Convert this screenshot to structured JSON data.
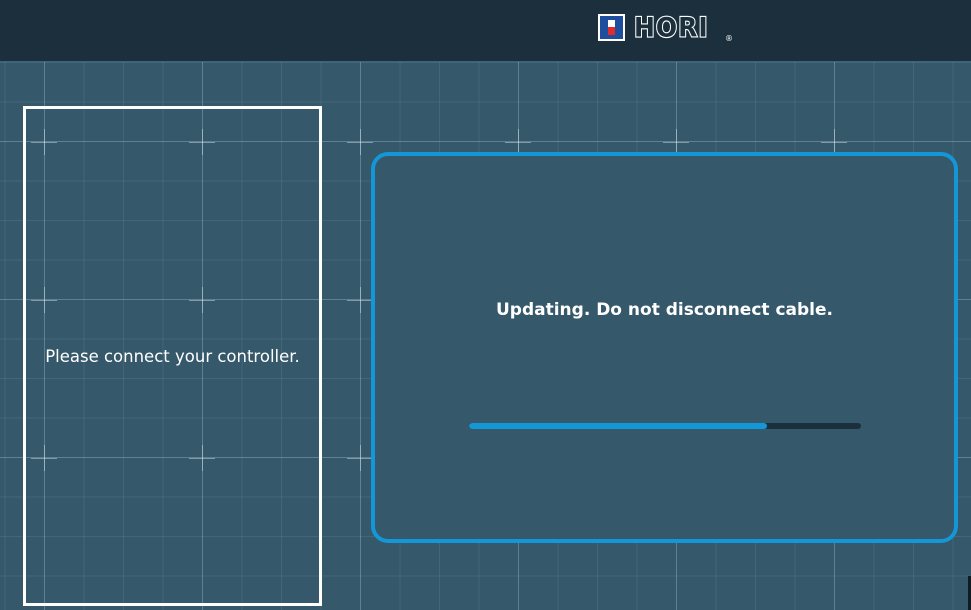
{
  "header": {
    "brand_name": "HORI",
    "registered_mark": "®",
    "logo_icon": "hori-logo-icon"
  },
  "left_panel": {
    "message": "Please connect your controller."
  },
  "update_card": {
    "message": "Updating. Do not disconnect cable.",
    "progress_fraction": 0.76
  },
  "colors": {
    "header_bg": "#1b2f3c",
    "page_bg": "#35586b",
    "accent": "#1497d6",
    "panel_border": "#ffffff",
    "logo_blue": "#1d4f9e",
    "logo_red": "#e22b2b"
  }
}
